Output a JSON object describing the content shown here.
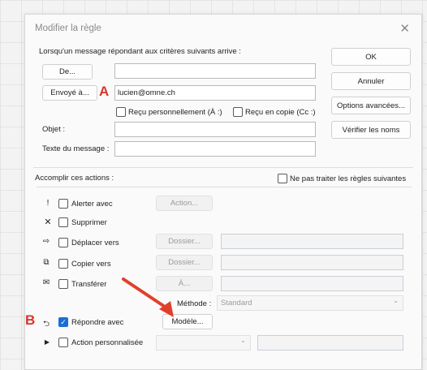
{
  "dialog": {
    "title": "Modifier la règle"
  },
  "conditions": {
    "heading": "Lorsqu'un message répondant aux critères suivants arrive :",
    "from_button": "De...",
    "from_value": "",
    "sent_to_button": "Envoyé à...",
    "sent_to_value": "lucien@omne.ch",
    "received_personally": "Reçu personnellement (À :)",
    "received_cc": "Reçu en copie (Cc :)",
    "subject_label": "Objet :",
    "subject_value": "",
    "body_label": "Texte du message :",
    "body_value": ""
  },
  "side_buttons": {
    "ok": "OK",
    "cancel": "Annuler",
    "advanced": "Options avancées...",
    "check_names": "Vérifier les noms"
  },
  "actions": {
    "heading": "Accomplir ces actions :",
    "stop_rules": "Ne pas traiter les règles suivantes",
    "alert": {
      "label": "Alerter avec",
      "button": "Action..."
    },
    "delete": {
      "label": "Supprimer"
    },
    "move": {
      "label": "Déplacer vers",
      "button": "Dossier..."
    },
    "copy": {
      "label": "Copier vers",
      "button": "Dossier..."
    },
    "forward": {
      "label": "Transférer",
      "button": "À...",
      "method_label": "Méthode :",
      "method_value": "Standard"
    },
    "reply": {
      "label": "Répondre avec",
      "button": "Modèle...",
      "checked": true
    },
    "custom": {
      "label": "Action personnalisée"
    }
  },
  "annotations": {
    "a": "A",
    "b": "B",
    "arrow_color": "#e0402a"
  }
}
